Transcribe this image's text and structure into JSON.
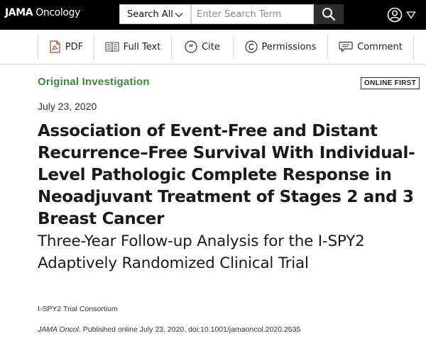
{
  "header": {
    "brand_bold": "JAMA",
    "brand_rest": " Oncology",
    "search_scope": "Search All",
    "search_placeholder": "Enter Search Term"
  },
  "toolbar": {
    "items": [
      {
        "label": "PDF",
        "icon": "pdf-icon"
      },
      {
        "label": "Full Text",
        "icon": "full-text-icon"
      },
      {
        "label": "Cite",
        "icon": "cite-icon"
      },
      {
        "label": "Permissions",
        "icon": "copyright-icon"
      },
      {
        "label": "Comment",
        "icon": "comment-icon"
      }
    ]
  },
  "article": {
    "type": "Original Investigation",
    "badge": "ONLINE FIRST",
    "date": "July 23, 2020",
    "title": "Association of Event-Free and Distant Recurrence–Free Survival With Individual-Level Pathologic Complete Response in Neoadjuvant Treatment of Stages 2 and 3 Breast Cancer",
    "subtitle": "Three-Year Follow-up Analysis for the I-SPY2 Adaptively Randomized Clinical Trial",
    "authors": "I-SPY2 Trial Consortium",
    "citation_journal": "JAMA Oncol.",
    "citation_rest": " Published online July 23, 2020. doi:10.1001/jamaoncol.2020.2535"
  },
  "colors": {
    "header_bg": "#000000",
    "kicker_green": "#3b8a3e",
    "pdf_red": "#c0392b"
  }
}
